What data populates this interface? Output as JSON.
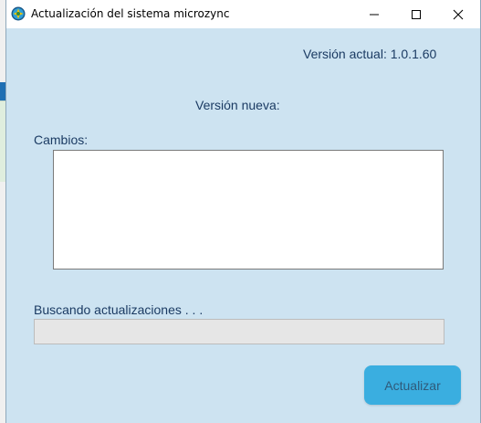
{
  "window": {
    "title": "Actualización del sistema microzync",
    "icon": "microzync-app-icon",
    "controls": [
      "minimize-icon",
      "maximize-icon",
      "close-icon"
    ]
  },
  "main": {
    "current_version_label": "Versión actual: 1.0.1.60",
    "new_version_label": "Versión nueva:",
    "changes_label": "Cambios:",
    "changes_text": "",
    "status_text": "Buscando actualizaciones . . .",
    "progress": 0,
    "update_button_label": "Actualizar"
  },
  "colors": {
    "client_bg": "#cde3f1",
    "label_text": "#1b3b63",
    "button_bg": "#3aaee0",
    "button_text": "#2f5a7a",
    "progress_track": "#e6e6e6"
  }
}
